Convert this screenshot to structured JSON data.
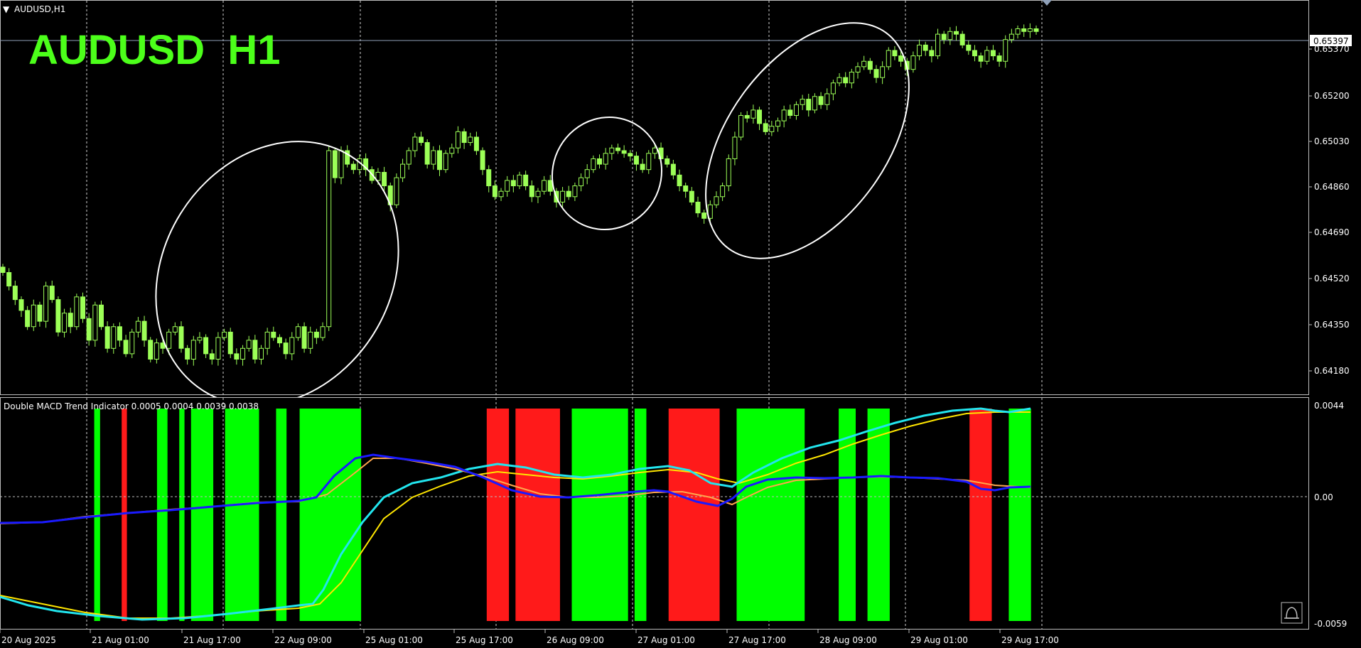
{
  "window": {
    "symbol_label": "AUDUSD,H1",
    "overlay_title": "AUDUSD  H1",
    "current_price": "0.65397"
  },
  "price_axis_labels": [
    "0.65370",
    "0.65200",
    "0.65030",
    "0.64860",
    "0.64690",
    "0.64520",
    "0.64350",
    "0.64180"
  ],
  "time_axis_labels": [
    "20 Aug 2025",
    "21 Aug 01:00",
    "21 Aug 17:00",
    "22 Aug 09:00",
    "25 Aug 01:00",
    "25 Aug 17:00",
    "26 Aug 09:00",
    "27 Aug 01:00",
    "27 Aug 17:00",
    "28 Aug 09:00",
    "29 Aug 01:00",
    "29 Aug 17:00"
  ],
  "indicator": {
    "label": "Double MACD Trend Indicator 0.0005 0.0004 0.0039 0.0038",
    "axis_labels": [
      "0.0044",
      "0.00",
      "-0.0059"
    ]
  },
  "colors": {
    "background": "#000000",
    "candle": "#9cff57",
    "title": "#4cff1a",
    "grid": "#cfcfcf",
    "bar_up": "#00ff00",
    "bar_down": "#ff1a1a",
    "fast_macd": "#1a1aff",
    "fast_signal": "#ffa64d",
    "slow_macd": "#22e5ee",
    "slow_signal": "#ffe600",
    "highlight_ellipse": "#ffffff"
  },
  "chart_data": {
    "type": "candlestick",
    "y_range": [
      0.641,
      0.6548
    ],
    "current_price": 0.65397,
    "candles_close": [
      0.645,
      0.6445,
      0.644,
      0.6436,
      0.643,
      0.6438,
      0.6432,
      0.6445,
      0.644,
      0.6428,
      0.6435,
      0.643,
      0.6441,
      0.6433,
      0.6425,
      0.6438,
      0.643,
      0.6422,
      0.643,
      0.6425,
      0.642,
      0.6428,
      0.6432,
      0.6425,
      0.6418,
      0.6424,
      0.6422,
      0.6428,
      0.643,
      0.6422,
      0.6418,
      0.6425,
      0.6426,
      0.642,
      0.6418,
      0.6426,
      0.6428,
      0.642,
      0.6418,
      0.6422,
      0.6425,
      0.6418,
      0.6422,
      0.6428,
      0.6426,
      0.6424,
      0.642,
      0.6426,
      0.643,
      0.6422,
      0.6428,
      0.6426,
      0.643,
      0.6495,
      0.6485,
      0.6495,
      0.649,
      0.6488,
      0.6492,
      0.6488,
      0.6484,
      0.6487,
      0.6482,
      0.6475,
      0.6485,
      0.649,
      0.6495,
      0.65,
      0.6498,
      0.649,
      0.6495,
      0.6488,
      0.6494,
      0.6496,
      0.6502,
      0.6498,
      0.65,
      0.6495,
      0.6488,
      0.6482,
      0.6478,
      0.648,
      0.6484,
      0.6482,
      0.6486,
      0.6482,
      0.6478,
      0.648,
      0.6484,
      0.648,
      0.6476,
      0.648,
      0.6478,
      0.6482,
      0.6485,
      0.6488,
      0.6492,
      0.649,
      0.6494,
      0.6496,
      0.6495,
      0.6494,
      0.6493,
      0.649,
      0.6488,
      0.6494,
      0.6496,
      0.6492,
      0.649,
      0.6486,
      0.6482,
      0.648,
      0.6476,
      0.6472,
      0.647,
      0.6475,
      0.6478,
      0.6482,
      0.6492,
      0.65,
      0.6508,
      0.6507,
      0.651,
      0.6505,
      0.6502,
      0.6504,
      0.6506,
      0.651,
      0.6508,
      0.6512,
      0.6514,
      0.651,
      0.6515,
      0.6512,
      0.6516,
      0.652,
      0.6522,
      0.652,
      0.6524,
      0.6526,
      0.6528,
      0.6525,
      0.6522,
      0.6526,
      0.6532,
      0.653,
      0.6528,
      0.6525,
      0.653,
      0.6534,
      0.6532,
      0.653,
      0.6538,
      0.6536,
      0.6539,
      0.6538,
      0.6534,
      0.6532,
      0.653,
      0.6528,
      0.6532,
      0.653,
      0.6528,
      0.6536,
      0.6538,
      0.654,
      0.6539,
      0.654,
      0.6539
    ]
  },
  "macd_data": {
    "range": [
      -0.0059,
      0.0044
    ],
    "trend_blocks": [
      {
        "from": 0.072,
        "to": 0.0765,
        "trend": "up"
      },
      {
        "from": 0.093,
        "to": 0.097,
        "trend": "down"
      },
      {
        "from": 0.12,
        "to": 0.128,
        "trend": "up"
      },
      {
        "from": 0.137,
        "to": 0.141,
        "trend": "up"
      },
      {
        "from": 0.146,
        "to": 0.163,
        "trend": "up"
      },
      {
        "from": 0.172,
        "to": 0.198,
        "trend": "up"
      },
      {
        "from": 0.211,
        "to": 0.219,
        "trend": "up"
      },
      {
        "from": 0.229,
        "to": 0.276,
        "trend": "up"
      },
      {
        "from": 0.372,
        "to": 0.389,
        "trend": "down"
      },
      {
        "from": 0.394,
        "to": 0.428,
        "trend": "down"
      },
      {
        "from": 0.437,
        "to": 0.48,
        "trend": "up"
      },
      {
        "from": 0.485,
        "to": 0.494,
        "trend": "up"
      },
      {
        "from": 0.511,
        "to": 0.55,
        "trend": "down"
      },
      {
        "from": 0.563,
        "to": 0.615,
        "trend": "up"
      },
      {
        "from": 0.641,
        "to": 0.654,
        "trend": "up"
      },
      {
        "from": 0.663,
        "to": 0.68,
        "trend": "up"
      },
      {
        "from": 0.741,
        "to": 0.758,
        "trend": "down"
      },
      {
        "from": 0.771,
        "to": 0.788,
        "trend": "up"
      }
    ]
  }
}
